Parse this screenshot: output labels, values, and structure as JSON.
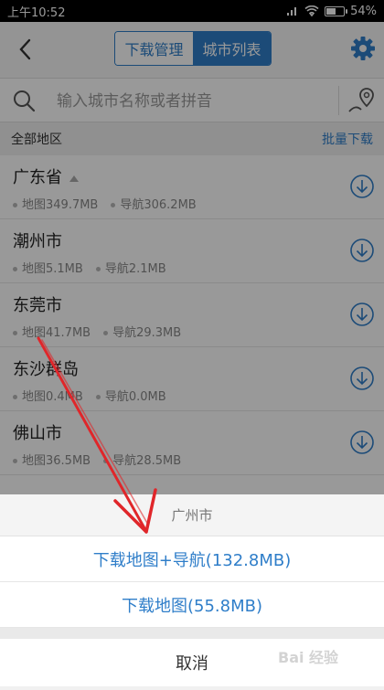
{
  "status": {
    "time": "上午10:52",
    "battery": "54%",
    "battery_level": 0.54
  },
  "header": {
    "tabs": [
      {
        "label": "下载管理"
      },
      {
        "label": "城市列表"
      }
    ]
  },
  "search": {
    "placeholder": "输入城市名称或者拼音"
  },
  "section": {
    "title": "全部地区",
    "batch_download": "批量下载"
  },
  "list": [
    {
      "name": "广东省",
      "map": "地图349.7MB",
      "nav": "导航306.2MB"
    },
    {
      "name": "潮州市",
      "map": "地图5.1MB",
      "nav": "导航2.1MB"
    },
    {
      "name": "东莞市",
      "map": "地图41.7MB",
      "nav": "导航29.3MB"
    },
    {
      "name": "东沙群岛",
      "map": "地图0.4MB",
      "nav": "导航0.0MB"
    },
    {
      "name": "佛山市",
      "map": "地图36.5MB",
      "nav": "导航28.5MB"
    }
  ],
  "sheet": {
    "title": "广州市",
    "option1": "下载地图+导航(132.8MB)",
    "option2": "下载地图(55.8MB)",
    "cancel": "取消"
  },
  "watermark": {
    "text": "Bai 经验"
  },
  "colors": {
    "accent": "#2f7ec9",
    "annotation_arrow": "#e0262a"
  }
}
